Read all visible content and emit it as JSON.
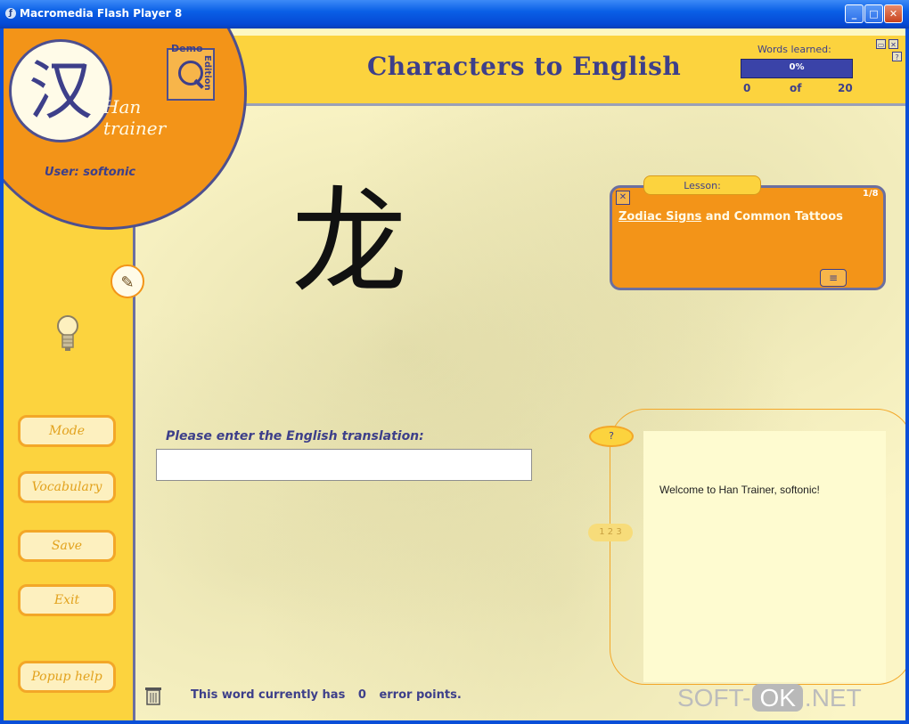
{
  "window": {
    "title": "Macromedia Flash Player 8",
    "minimize": "_",
    "maximize": "□",
    "close": "✕"
  },
  "app": {
    "logo_char": "汉",
    "logo_text": "Han\ntrainer",
    "user_label": "User: softonic",
    "demo_label": "Demo",
    "edition_label": "Edition",
    "page_title": "Characters to English"
  },
  "progress": {
    "label": "Words learned:",
    "percent_text": "0%",
    "percent": 0,
    "from": "0",
    "of": "of",
    "to": "20"
  },
  "corner_buttons": {
    "fullscreen": "▭",
    "close": "✕",
    "help": "?"
  },
  "quiz": {
    "character": "龙",
    "prompt": "Please enter the English translation:",
    "answer_value": ""
  },
  "lesson": {
    "tab_label": "Lesson:",
    "count": "1/8",
    "close": "✕",
    "link_text": "Zodiac Signs",
    "rest_text": " and Common Tattoos",
    "list_icon": "≡"
  },
  "menu": {
    "mode": "Mode",
    "vocabulary": "Vocabulary",
    "save": "Save",
    "exit": "Exit",
    "popup_help": "Popup help"
  },
  "help": {
    "question": "?",
    "message": "Welcome to Han Trainer, softonic!",
    "pages": "1 2 3"
  },
  "status": {
    "prefix": "This word currently has",
    "count": "0",
    "suffix": "error points."
  },
  "watermark": {
    "left": "SOFT-",
    "mid": "OK",
    "right": ".NET"
  },
  "icons": {
    "pencil": "✎",
    "bulb": "💡",
    "trash": "🗑"
  },
  "colors": {
    "orange": "#f39418",
    "yellow": "#fcd33e",
    "navy": "#3d3f8a",
    "xp_blue": "#0a5fe6"
  }
}
